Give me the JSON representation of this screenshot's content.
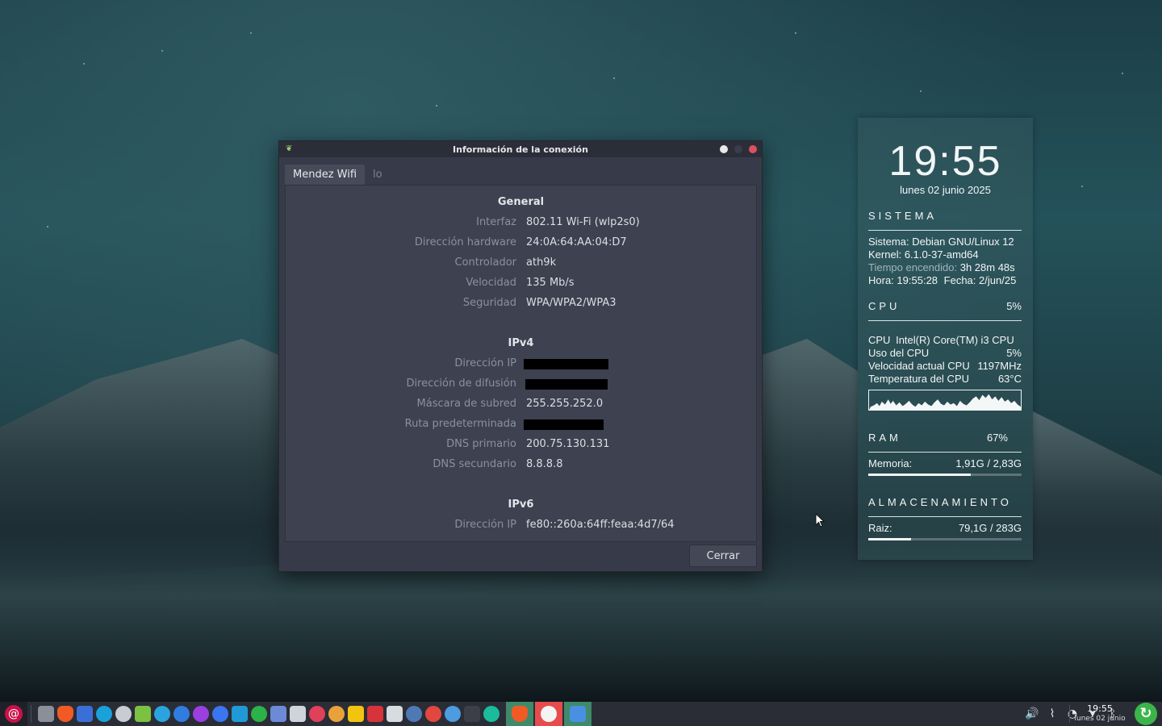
{
  "dialog": {
    "title": "Información de la conexión",
    "tabs": [
      {
        "label": "Mendez Wifi",
        "active": true
      },
      {
        "label": "lo",
        "active": false
      }
    ],
    "sections": {
      "general": {
        "title": "General",
        "rows": [
          {
            "label": "Interfaz",
            "value": "802.11 Wi-Fi (wlp2s0)"
          },
          {
            "label": "Dirección hardware",
            "value": "24:0A:64:AA:04:D7"
          },
          {
            "label": "Controlador",
            "value": "ath9k"
          },
          {
            "label": "Velocidad",
            "value": "135 Mb/s"
          },
          {
            "label": "Seguridad",
            "value": "WPA/WPA2/WPA3"
          }
        ]
      },
      "ipv4": {
        "title": "IPv4",
        "rows": [
          {
            "label": "Dirección IP",
            "value": ""
          },
          {
            "label": "Dirección de difusión",
            "value": ""
          },
          {
            "label": "Máscara de subred",
            "value": "255.255.252.0"
          },
          {
            "label": "Ruta predeterminada",
            "value": ""
          },
          {
            "label": "DNS primario",
            "value": "200.75.130.131"
          },
          {
            "label": "DNS secundario",
            "value": "8.8.8.8"
          }
        ]
      },
      "ipv6": {
        "title": "IPv6",
        "rows": [
          {
            "label": "Dirección IP",
            "value": "fe80::260a:64ff:feaa:4d7/64"
          }
        ]
      }
    },
    "close_label": "Cerrar"
  },
  "conky": {
    "time": "19:55",
    "date": "lunes 02 junio 2025",
    "system": {
      "header": "SISTEMA",
      "sistema_label": "Sistema:",
      "sistema_value": "Debian GNU/Linux 12",
      "kernel_label": "Kernel:",
      "kernel_value": "6.1.0-37-amd64",
      "uptime_label": "Tiempo encendido:",
      "uptime_value": "3h 28m 48s",
      "hora_label": "Hora:",
      "hora_value": "19:55:28",
      "fecha_label": "Fecha:",
      "fecha_value": "2/jun/25"
    },
    "cpu": {
      "header": "CPU",
      "percent": "5%",
      "model_label": "CPU",
      "model_value": "Intel(R) Core(TM) i3 CPU",
      "usage_label": "Uso del CPU",
      "usage_value": "5%",
      "speed_label": "Velocidad actual CPU",
      "speed_value": "1197MHz",
      "temp_label": "Temperatura del CPU",
      "temp_value": "63°C"
    },
    "ram": {
      "header": "RAM",
      "percent": "67%",
      "mem_label": "Memoria:",
      "mem_value": "1,91G / 2,83G",
      "fraction": 0.67
    },
    "storage": {
      "header": "ALMACENAMIENTO",
      "root_label": "Raiz:",
      "root_value": "79,1G / 283G",
      "fraction": 0.28
    }
  },
  "taskbar": {
    "clock_time": "19:55",
    "clock_date": "lunes 02 junio"
  }
}
